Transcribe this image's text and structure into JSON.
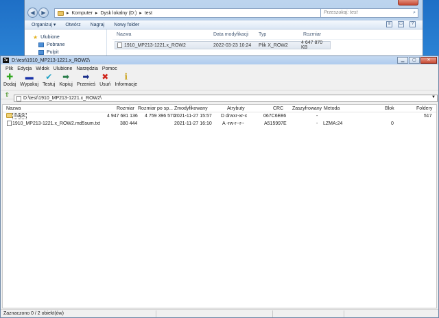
{
  "explorer": {
    "breadcrumb": [
      "Komputer",
      "Dysk lokalny (D:)",
      "test"
    ],
    "search_placeholder": "Przeszukaj: test",
    "toolbar": [
      "Organizuj ▾",
      "Otwórz",
      "Nagraj",
      "Nowy folder"
    ],
    "nav": [
      "Ulubione",
      "Pobrane",
      "Pulpit"
    ],
    "columns": {
      "name": "Nazwa",
      "date": "Data modyfikacji",
      "type": "Typ",
      "size": "Rozmiar"
    },
    "row": {
      "name": "1910_MP213-1221.x_ROW2",
      "date": "2022-03-23 10:24",
      "type": "Plik X_ROW2",
      "size": "4 647 870 KB"
    }
  },
  "zip": {
    "title": "D:\\test\\1910_MP213-1221.x_ROW2\\",
    "logo_text": "7z",
    "menu": [
      "Plik",
      "Edycja",
      "Widok",
      "Ulubione",
      "Narzędzia",
      "Pomoc"
    ],
    "toolbar": [
      {
        "label": "Dodaj",
        "icon": "plus-icon",
        "color": "#2ea51b",
        "glyph": "✚"
      },
      {
        "label": "Wypakuj",
        "icon": "minus-icon",
        "color": "#1a33a8",
        "glyph": "▬"
      },
      {
        "label": "Testuj",
        "icon": "check-icon",
        "color": "#1ba0c4",
        "glyph": "✔"
      },
      {
        "label": "Kopiuj",
        "icon": "copy-arrow-icon",
        "color": "#2a7d4a",
        "glyph": "➡"
      },
      {
        "label": "Przenieś",
        "icon": "move-arrow-icon",
        "color": "#1b2f8a",
        "glyph": "➡"
      },
      {
        "label": "Usuń",
        "icon": "delete-x-icon",
        "color": "#d0241a",
        "glyph": "✖"
      },
      {
        "label": "Informacje",
        "icon": "info-icon",
        "color": "#c9a21a",
        "glyph": "i"
      }
    ],
    "path": "D:\\test\\1910_MP213-1221.x_ROW2\\",
    "columns": {
      "name": "Nazwa",
      "size": "Rozmiar",
      "packed": "Rozmiar po sp...",
      "modified": "Zmodyfikowany",
      "attr": "Atrybuty",
      "crc": "CRC",
      "encrypted": "Zaszyfrowany",
      "method": "Metoda",
      "block": "Blok",
      "folders": "Foldery"
    },
    "rows": [
      {
        "name": "maps",
        "size": "4 947 681 136",
        "packed": "4 759 396 570",
        "modified": "2021-11-27 15:57",
        "attr": "D drwxr-xr-x",
        "crc": "067C6E86",
        "encrypted": "-",
        "method": "",
        "block": "",
        "folders": "517"
      },
      {
        "name": "1910_MP213-1221.x_ROW2.md5sum.txt",
        "size": "380 444",
        "packed": "",
        "modified": "2021-11-27 16:10",
        "attr": "A -rw-r--r--",
        "crc": "A515997E",
        "encrypted": "-",
        "method": "LZMA:24",
        "block": "0",
        "folders": ""
      }
    ],
    "status": "Zaznaczono 0 / 2 obiekt(ów)"
  }
}
